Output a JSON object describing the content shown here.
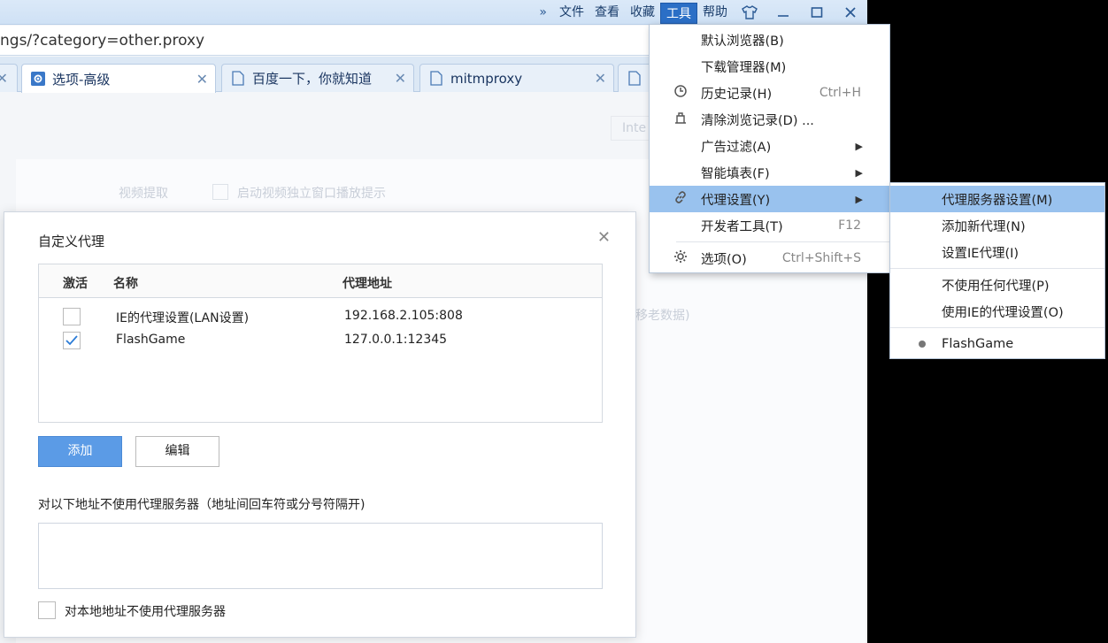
{
  "menubar": {
    "more": "»",
    "items": [
      "文件",
      "查看",
      "收藏",
      "工具",
      "帮助"
    ],
    "active": "工具"
  },
  "address": {
    "url": "ngs/?category=other.proxy"
  },
  "tabs": [
    {
      "label": "选项-高级",
      "active": true
    },
    {
      "label": "百度一下，你就知道",
      "active": false
    },
    {
      "label": "mitmproxy",
      "active": false
    }
  ],
  "background_page": {
    "video_label": "视频提取",
    "video_option": "启动视频独立窗口播放提示",
    "search_placeholder": "Inte",
    "faded_tail": "移老数据)"
  },
  "dialog": {
    "title": "自定义代理",
    "columns": [
      "激活",
      "名称",
      "代理地址"
    ],
    "rows": [
      {
        "active": false,
        "name": "IE的代理设置(LAN设置)",
        "address": "192.168.2.105:808"
      },
      {
        "active": true,
        "name": "FlashGame",
        "address": "127.0.0.1:12345"
      }
    ],
    "add_label": "添加",
    "edit_label": "编辑",
    "bypass_label": "对以下地址不使用代理服务器（地址间回车符或分号符隔开)",
    "bypass_value": "",
    "local_label": "对本地地址不使用代理服务器"
  },
  "tools_menu": {
    "items": [
      {
        "label": "默认浏览器(B)",
        "shortcut": "",
        "icon": "",
        "submenu": false
      },
      {
        "label": "下载管理器(M)",
        "shortcut": "",
        "icon": "",
        "submenu": false
      },
      {
        "label": "历史记录(H)",
        "shortcut": "Ctrl+H",
        "icon": "clock-icon",
        "submenu": false
      },
      {
        "label": "清除浏览记录(D) ...",
        "shortcut": "",
        "icon": "eraser-icon",
        "submenu": false
      },
      {
        "label": "广告过滤(A)",
        "shortcut": "",
        "icon": "",
        "submenu": true
      },
      {
        "label": "智能填表(F)",
        "shortcut": "",
        "icon": "",
        "submenu": true
      },
      {
        "label": "代理设置(Y)",
        "shortcut": "",
        "icon": "link-icon",
        "submenu": true,
        "highlighted": true
      },
      {
        "label": "开发者工具(T)",
        "shortcut": "F12",
        "icon": "",
        "submenu": false
      },
      {
        "label": "选项(O)",
        "shortcut": "Ctrl+Shift+S",
        "icon": "gear-icon",
        "submenu": false
      }
    ]
  },
  "proxy_submenu": {
    "items": [
      {
        "label": "代理服务器设置(M)",
        "highlighted": true
      },
      {
        "label": "添加新代理(N)"
      },
      {
        "label": "设置IE代理(I)"
      },
      {
        "label": "不使用任何代理(P)"
      },
      {
        "label": "使用IE的代理设置(O)"
      },
      {
        "label": "FlashGame",
        "selected": true
      }
    ]
  }
}
